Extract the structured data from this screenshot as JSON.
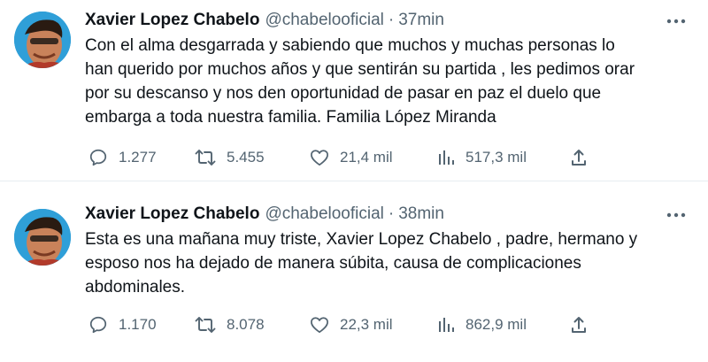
{
  "tweets": [
    {
      "name": "Xavier Lopez Chabelo",
      "handle": "@chabelooficial",
      "separator": "·",
      "time": "37min",
      "text": "Con el alma desgarrada y sabiendo que muchos y muchas personas lo\nhan querido por muchos años y que sentirán su partida , les pedimos orar\npor su descanso  y nos den oportunidad de pasar en paz  el duelo que\nembarga a toda nuestra familia.  Familia López Miranda",
      "replies": "1.277",
      "retweets": "5.455",
      "likes": "21,4 mil",
      "views": "517,3 mil"
    },
    {
      "name": "Xavier Lopez Chabelo",
      "handle": "@chabelooficial",
      "separator": "·",
      "time": "38min",
      "text": "Esta es una mañana muy triste,  Xavier Lopez Chabelo , padre, hermano y\nesposo nos ha dejado de manera súbita, causa de complicaciones\nabdominales.",
      "replies": "1.170",
      "retweets": "8.078",
      "likes": "22,3 mil",
      "views": "862,9 mil"
    }
  ],
  "icons": {
    "reply": "reply-icon",
    "retweet": "retweet-icon",
    "like": "heart-icon",
    "views": "views-icon",
    "share": "share-icon",
    "more": "more-icon"
  },
  "colors": {
    "text": "#0f1419",
    "secondary": "#536471",
    "divider": "#e6ecf0"
  }
}
